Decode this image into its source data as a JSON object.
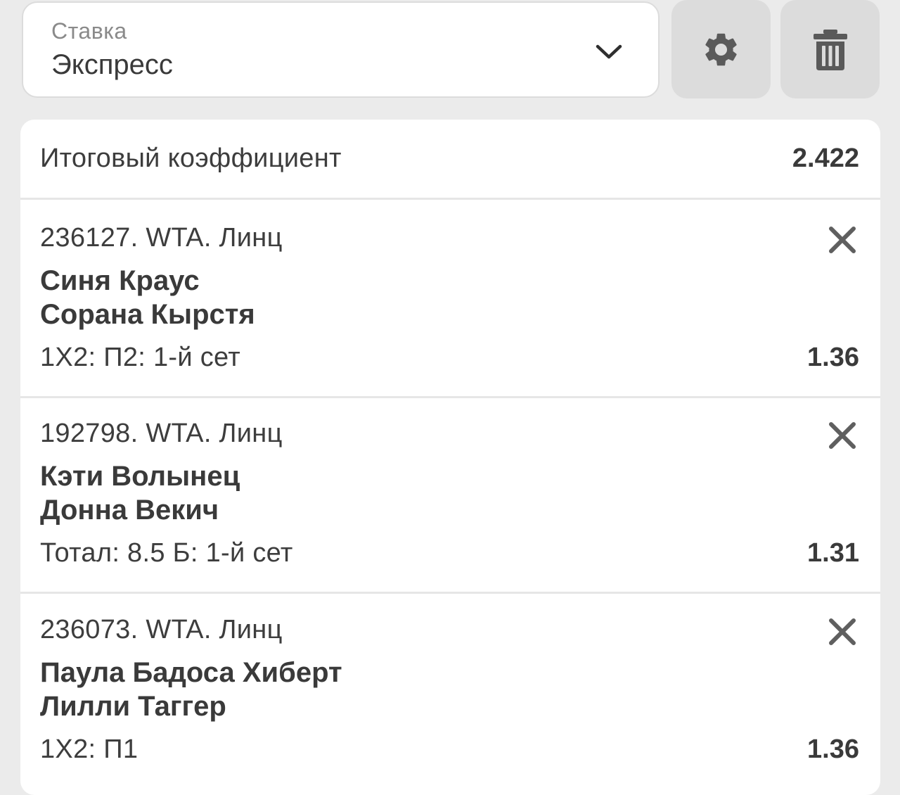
{
  "bet_type": {
    "label": "Ставка",
    "value": "Экспресс"
  },
  "icons": {
    "dropdown": "chevron-down-icon",
    "settings": "gear-icon",
    "delete": "trash-icon",
    "remove": "close-icon"
  },
  "colors": {
    "background": "#ebebeb",
    "card": "#ffffff",
    "icon_button": "#dcdcdc",
    "icon": "#5a5a5a",
    "text": "#3a3a3a"
  },
  "summary": {
    "total_label": "Итоговый коэффициент",
    "total_value": "2.422"
  },
  "events": [
    {
      "league": "236127. WTA. Линц",
      "team1": "Синя Краус",
      "team2": "Сорана Кырстя",
      "market": "1X2: П2: 1-й сет",
      "odds": "1.36"
    },
    {
      "league": "192798. WTA. Линц",
      "team1": "Кэти Волынец",
      "team2": "Донна Векич",
      "market": "Тотал: 8.5 Б: 1-й сет",
      "odds": "1.31"
    },
    {
      "league": "236073. WTA. Линц",
      "team1": "Паула Бадоса Хиберт",
      "team2": "Лилли Таггер",
      "market": "1X2: П1",
      "odds": "1.36"
    }
  ]
}
